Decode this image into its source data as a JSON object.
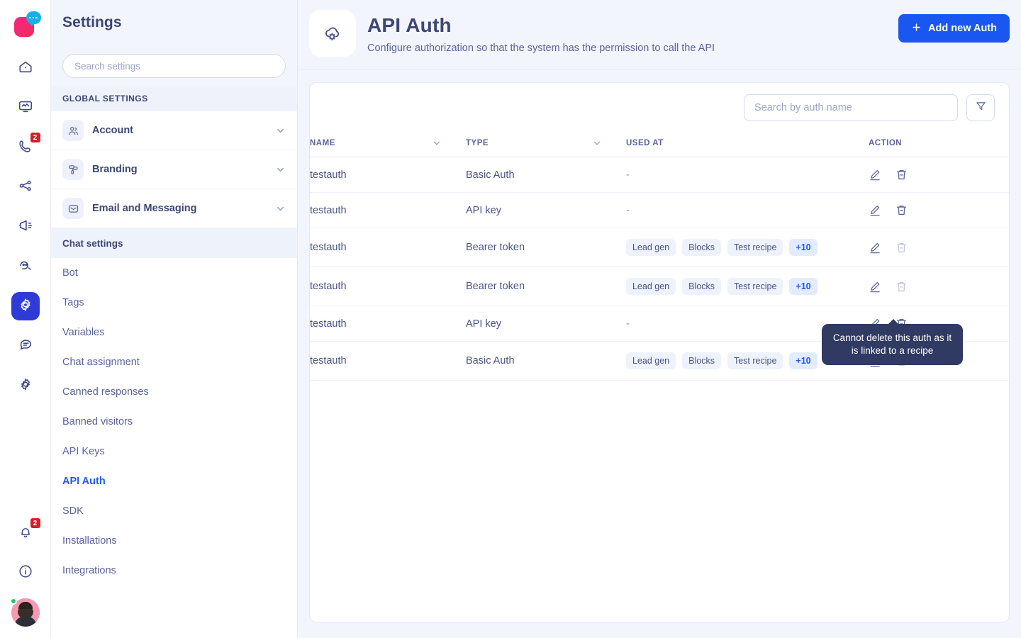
{
  "rail": {
    "logo_name": "brand-logo",
    "items": [
      {
        "icon": "home-icon",
        "name": "home",
        "badge": null,
        "active": false
      },
      {
        "icon": "dashboard-icon",
        "name": "dashboard",
        "badge": null,
        "active": false
      },
      {
        "icon": "phone-icon",
        "name": "calls",
        "badge": "2",
        "active": false
      },
      {
        "icon": "flow-icon",
        "name": "flows",
        "badge": null,
        "active": false
      },
      {
        "icon": "broadcast-icon",
        "name": "campaigns",
        "badge": null,
        "active": false
      },
      {
        "icon": "bot-icon",
        "name": "bots",
        "badge": null,
        "active": false
      },
      {
        "icon": "gear-icon",
        "name": "settings",
        "badge": null,
        "active": true
      },
      {
        "icon": "chat-search-icon",
        "name": "chat-search",
        "badge": null,
        "active": false
      },
      {
        "icon": "gear-alt-icon",
        "name": "preferences",
        "badge": null,
        "active": false
      }
    ],
    "bottom_items": [
      {
        "icon": "bell-icon",
        "name": "notifications",
        "badge": "2"
      },
      {
        "icon": "info-icon",
        "name": "help",
        "badge": null
      }
    ],
    "avatar_name": "user-avatar",
    "avatar_status": "online"
  },
  "settings": {
    "title": "Settings",
    "search": {
      "placeholder": "Search settings",
      "value": ""
    },
    "global_caption": "GLOBAL SETTINGS",
    "groups": [
      {
        "label": "Account",
        "icon": "users-icon"
      },
      {
        "label": "Branding",
        "icon": "paint-roller-icon"
      },
      {
        "label": "Email and Messaging",
        "icon": "envelope-icon"
      }
    ],
    "chat_caption": "Chat settings",
    "nav_items": [
      {
        "label": "Bot",
        "active": false
      },
      {
        "label": "Tags",
        "active": false
      },
      {
        "label": "Variables",
        "active": false
      },
      {
        "label": "Chat assignment",
        "active": false
      },
      {
        "label": "Canned responses",
        "active": false
      },
      {
        "label": "Banned visitors",
        "active": false
      },
      {
        "label": "API Keys",
        "active": false
      },
      {
        "label": "API Auth",
        "active": true
      },
      {
        "label": "SDK",
        "active": false
      },
      {
        "label": "Installations",
        "active": false
      },
      {
        "label": "Integrations",
        "active": false
      }
    ]
  },
  "page": {
    "icon": "cloud-gear-icon",
    "title": "API Auth",
    "subtitle": "Configure authorization so that the system has the permission to call the API",
    "add_button": "Add new Auth",
    "add_button_icon": "plus-icon",
    "accent_color": "#1a56f0"
  },
  "toolbar": {
    "search": {
      "placeholder": "Search by auth name",
      "value": ""
    },
    "filter_icon": "filter-icon"
  },
  "table": {
    "columns": [
      {
        "label": "NAME",
        "sortable": true
      },
      {
        "label": "TYPE",
        "sortable": true
      },
      {
        "label": "USED AT",
        "sortable": false
      },
      {
        "label": "ACTION",
        "sortable": false
      }
    ],
    "rows": [
      {
        "name": "testauth",
        "type": "Basic Auth",
        "used_at": [],
        "used_at_empty": "-",
        "edit_icon": "pencil-icon",
        "delete_icon": "trash-icon",
        "delete_disabled": false
      },
      {
        "name": "testauth",
        "type": "API key",
        "used_at": [],
        "used_at_empty": "-",
        "edit_icon": "pencil-icon",
        "delete_icon": "trash-icon",
        "delete_disabled": false
      },
      {
        "name": "testauth",
        "type": "Bearer token",
        "used_at": [
          "Lead gen",
          "Blocks",
          "Test recipe"
        ],
        "used_at_more": "+10",
        "used_at_empty": "",
        "edit_icon": "pencil-icon",
        "delete_icon": "trash-icon",
        "delete_disabled": true
      },
      {
        "name": "testauth",
        "type": "Bearer token",
        "used_at": [
          "Lead gen",
          "Blocks",
          "Test recipe"
        ],
        "used_at_more": "+10",
        "used_at_empty": "",
        "edit_icon": "pencil-icon",
        "delete_icon": "trash-icon",
        "delete_disabled": true
      },
      {
        "name": "testauth",
        "type": "API key",
        "used_at": [],
        "used_at_empty": "-",
        "edit_icon": "pencil-icon",
        "delete_icon": "trash-icon",
        "delete_disabled": false
      },
      {
        "name": "testauth",
        "type": "Basic Auth",
        "used_at": [
          "Lead gen",
          "Blocks",
          "Test recipe"
        ],
        "used_at_more": "+10",
        "used_at_empty": "",
        "edit_icon": "pencil-icon",
        "delete_icon": "trash-icon",
        "delete_disabled": true
      }
    ]
  },
  "tooltip": {
    "text": "Cannot delete this auth as it is linked to a recipe",
    "background": "#303a63"
  }
}
